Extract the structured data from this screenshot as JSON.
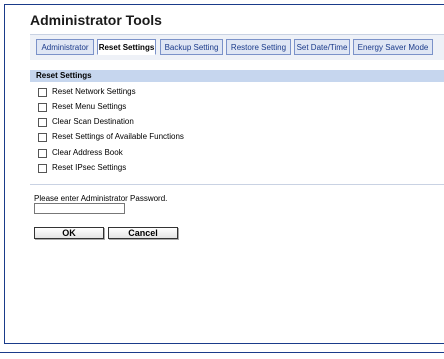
{
  "page": {
    "title": "Administrator Tools"
  },
  "tabs": [
    {
      "label": "Administrator",
      "active": false
    },
    {
      "label": "Reset Settings",
      "active": true
    },
    {
      "label": "Backup Setting",
      "active": false
    },
    {
      "label": "Restore Setting",
      "active": false
    },
    {
      "label": "Set Date/Time",
      "active": false
    },
    {
      "label": "Energy Saver Mode",
      "active": false
    }
  ],
  "reset_settings": {
    "heading": "Reset Settings",
    "options": [
      {
        "label": "Reset Network Settings",
        "checked": false
      },
      {
        "label": "Reset Menu Settings",
        "checked": false
      },
      {
        "label": "Clear Scan Destination",
        "checked": false
      },
      {
        "label": "Reset Settings of Available Functions",
        "checked": false
      },
      {
        "label": "Clear Address Book",
        "checked": false
      },
      {
        "label": "Reset IPsec Settings",
        "checked": false
      }
    ]
  },
  "password": {
    "label": "Please enter Administrator Password.",
    "value": ""
  },
  "buttons": {
    "ok": "OK",
    "cancel": "Cancel"
  },
  "colors": {
    "frame_border": "#1a3b8a",
    "tab_active_bg": "#ffffff",
    "tab_bg": "#dfe6f4",
    "section_bg": "#c6d6ee"
  }
}
